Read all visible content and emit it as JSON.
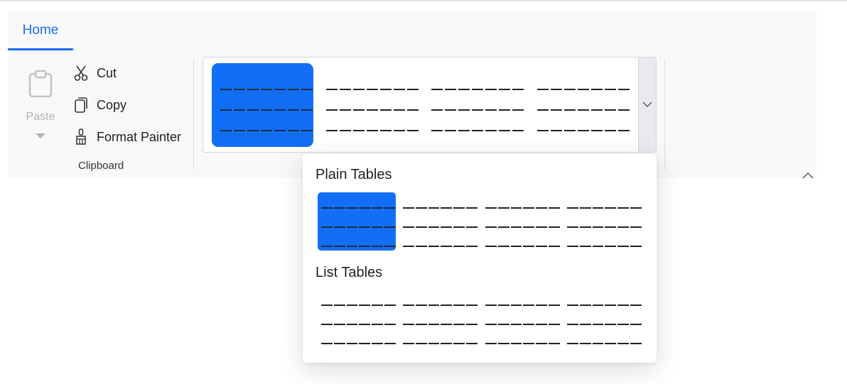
{
  "ribbon": {
    "tabs": [
      {
        "label": "Home",
        "active": true
      }
    ],
    "clipboard": {
      "paste_label": "Paste",
      "cut_label": "Cut",
      "copy_label": "Copy",
      "format_painter_label": "Format Painter",
      "group_label": "Clipboard"
    },
    "gallery": {
      "selected_index": 0,
      "item_count": 4
    }
  },
  "dropdown": {
    "sections": [
      {
        "title": "Plain Tables",
        "selected_index": 0
      },
      {
        "title": "List Tables"
      }
    ]
  },
  "colors": {
    "accent": "#1a6cf0",
    "selected_fill": "#136ef6",
    "ribbon_bg": "#f7f8fa",
    "disabled_text": "#b4b4b4"
  },
  "icons": [
    "paste-icon",
    "cut-icon",
    "copy-icon",
    "format-painter-icon",
    "chevron-down-icon",
    "chevron-up-icon"
  ]
}
